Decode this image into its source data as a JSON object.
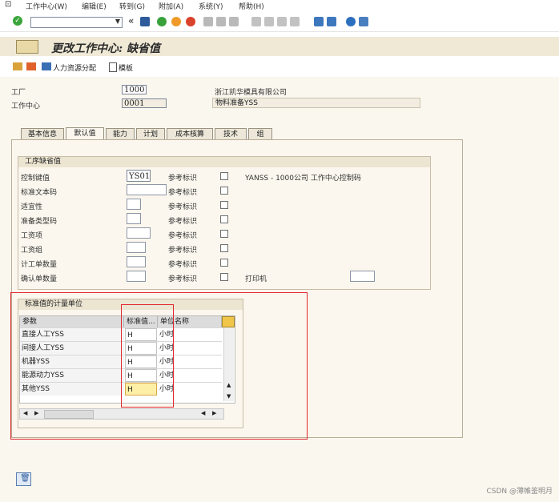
{
  "menu": {
    "items": [
      "工作中心(W)",
      "编辑(E)",
      "转到(G)",
      "附加(A)",
      "系统(Y)",
      "帮助(H)"
    ]
  },
  "toolbar": {
    "command_value": "",
    "history_symbol": "«"
  },
  "header": {
    "title": "更改工作中心: 缺省值"
  },
  "appbar": {
    "hr_assign": "人力资源分配",
    "template": "模板"
  },
  "fields": {
    "plant_label": "工厂",
    "plant_value": "1000",
    "plant_desc": "浙江凯华模具有限公司",
    "wc_label": "工作中心",
    "wc_value": "0001",
    "wc_desc": "物料准备YSS"
  },
  "tabs": [
    "基本信息",
    "默认值",
    "能力",
    "计划",
    "成本核算",
    "技术",
    "组"
  ],
  "defaults_group": {
    "title": "工序缺省值",
    "ref_label": "参考标识",
    "rows": [
      {
        "label": "控制键值",
        "value": "YS01"
      },
      {
        "label": "标准文本码",
        "value": ""
      },
      {
        "label": "适宜性",
        "value": ""
      },
      {
        "label": "准备类型码",
        "value": ""
      },
      {
        "label": "工资项",
        "value": ""
      },
      {
        "label": "工资组",
        "value": ""
      },
      {
        "label": "计工单数量",
        "value": ""
      },
      {
        "label": "确认单数量",
        "value": ""
      }
    ],
    "control_key_desc": "YANSS - 1000公司 工作中心控制码",
    "printer_label": "打印机"
  },
  "unit_group": {
    "title": "标准值的计量单位",
    "columns": [
      "参数",
      "标准值...",
      "单位名称"
    ],
    "rows": [
      {
        "param": "直接人工YSS",
        "unit": "H",
        "name": "小时"
      },
      {
        "param": "间接人工YSS",
        "unit": "H",
        "name": "小时"
      },
      {
        "param": "机器YSS",
        "unit": "H",
        "name": "小时"
      },
      {
        "param": "能源动力YSS",
        "unit": "H",
        "name": "小时"
      },
      {
        "param": "其他YSS",
        "unit": "H",
        "name": "小时"
      }
    ]
  },
  "watermark": "CSDN @薄帷鉴明月"
}
